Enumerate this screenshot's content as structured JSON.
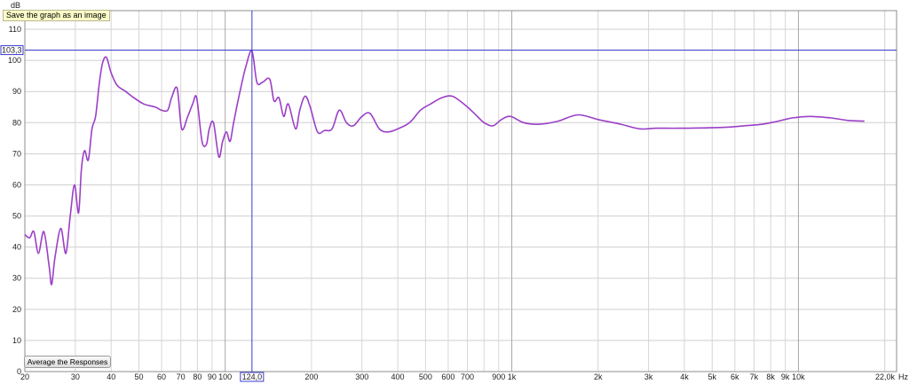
{
  "tooltip": "Save the graph as an image",
  "average_button": "Average the Responses",
  "cursor": {
    "x_label": "124,0",
    "y_label": "103,3"
  },
  "chart_data": {
    "type": "line",
    "x_scale": "log",
    "ylabel": "dB",
    "xunit": "Hz",
    "xlim": [
      20,
      22000
    ],
    "ylim": [
      0,
      116
    ],
    "grid": true,
    "yticks": [
      0,
      10,
      20,
      30,
      40,
      50,
      60,
      70,
      80,
      90,
      100,
      110
    ],
    "xtick_labels": [
      {
        "value": 20,
        "label": "20"
      },
      {
        "value": 30,
        "label": "30"
      },
      {
        "value": 40,
        "label": "40"
      },
      {
        "value": 50,
        "label": "50"
      },
      {
        "value": 60,
        "label": "60"
      },
      {
        "value": 70,
        "label": "70"
      },
      {
        "value": 80,
        "label": "80"
      },
      {
        "value": 90,
        "label": "90"
      },
      {
        "value": 100,
        "label": "100"
      },
      {
        "value": 200,
        "label": "200"
      },
      {
        "value": 300,
        "label": "300"
      },
      {
        "value": 400,
        "label": "400"
      },
      {
        "value": 500,
        "label": "500"
      },
      {
        "value": 600,
        "label": "600"
      },
      {
        "value": 700,
        "label": "700"
      },
      {
        "value": 900,
        "label": "900"
      },
      {
        "value": 1000,
        "label": "1k"
      },
      {
        "value": 2000,
        "label": "2k"
      },
      {
        "value": 3000,
        "label": "3k"
      },
      {
        "value": 4000,
        "label": "4k"
      },
      {
        "value": 5000,
        "label": "5k"
      },
      {
        "value": 6000,
        "label": "6k"
      },
      {
        "value": 7000,
        "label": "7k"
      },
      {
        "value": 8000,
        "label": "8k"
      },
      {
        "value": 9000,
        "label": "9k"
      },
      {
        "value": 10000,
        "label": "10k"
      },
      {
        "value": 22000,
        "label": "22,0k"
      }
    ],
    "cursor": {
      "x": 124,
      "y": 103.3
    },
    "series": [
      {
        "color": "#9b3fc7",
        "points": [
          [
            20,
            44
          ],
          [
            20.8,
            43
          ],
          [
            21.5,
            45
          ],
          [
            22.3,
            38
          ],
          [
            23.3,
            45
          ],
          [
            24.3,
            34
          ],
          [
            24.8,
            28
          ],
          [
            25.5,
            37
          ],
          [
            26.7,
            46
          ],
          [
            27.8,
            38
          ],
          [
            28.8,
            50
          ],
          [
            29.8,
            60
          ],
          [
            30.8,
            51
          ],
          [
            31.5,
            65
          ],
          [
            32.3,
            71
          ],
          [
            33.3,
            68
          ],
          [
            34.3,
            78
          ],
          [
            35.3,
            82
          ],
          [
            36.3,
            92
          ],
          [
            37.3,
            99
          ],
          [
            38.5,
            101
          ],
          [
            40,
            96
          ],
          [
            42,
            92
          ],
          [
            45,
            90
          ],
          [
            48,
            88
          ],
          [
            52,
            86
          ],
          [
            57,
            85
          ],
          [
            60,
            84
          ],
          [
            63,
            84
          ],
          [
            65,
            88
          ],
          [
            68,
            91
          ],
          [
            70.5,
            78
          ],
          [
            74,
            82
          ],
          [
            77,
            86
          ],
          [
            79.5,
            88
          ],
          [
            83,
            74
          ],
          [
            86,
            73
          ],
          [
            88,
            78
          ],
          [
            91,
            80
          ],
          [
            95,
            69
          ],
          [
            98,
            74
          ],
          [
            101,
            77
          ],
          [
            104,
            74
          ],
          [
            107,
            80
          ],
          [
            112,
            89
          ],
          [
            118,
            98
          ],
          [
            124,
            103
          ],
          [
            129,
            93
          ],
          [
            135,
            93
          ],
          [
            143,
            94
          ],
          [
            148,
            87
          ],
          [
            154,
            88
          ],
          [
            160,
            82
          ],
          [
            166,
            86
          ],
          [
            176,
            78
          ],
          [
            182,
            84
          ],
          [
            190,
            88.5
          ],
          [
            198,
            85
          ],
          [
            210,
            77
          ],
          [
            222,
            77.5
          ],
          [
            236,
            78
          ],
          [
            250,
            84
          ],
          [
            265,
            80
          ],
          [
            280,
            79
          ],
          [
            300,
            82
          ],
          [
            320,
            83
          ],
          [
            345,
            78
          ],
          [
            370,
            77
          ],
          [
            400,
            78
          ],
          [
            440,
            80
          ],
          [
            480,
            84
          ],
          [
            520,
            86
          ],
          [
            570,
            88
          ],
          [
            620,
            88.5
          ],
          [
            680,
            86
          ],
          [
            740,
            83
          ],
          [
            800,
            80
          ],
          [
            860,
            79
          ],
          [
            920,
            81
          ],
          [
            990,
            82
          ],
          [
            1100,
            80
          ],
          [
            1250,
            79.5
          ],
          [
            1450,
            80.5
          ],
          [
            1700,
            82.5
          ],
          [
            2000,
            81
          ],
          [
            2400,
            79.5
          ],
          [
            2800,
            78
          ],
          [
            3200,
            78.2
          ],
          [
            3800,
            78.2
          ],
          [
            4500,
            78.3
          ],
          [
            5500,
            78.5
          ],
          [
            6500,
            79
          ],
          [
            7500,
            79.5
          ],
          [
            8500,
            80.5
          ],
          [
            9500,
            81.5
          ],
          [
            11000,
            82
          ],
          [
            13000,
            81.5
          ],
          [
            15000,
            80.7
          ],
          [
            17000,
            80.5
          ]
        ]
      }
    ]
  }
}
